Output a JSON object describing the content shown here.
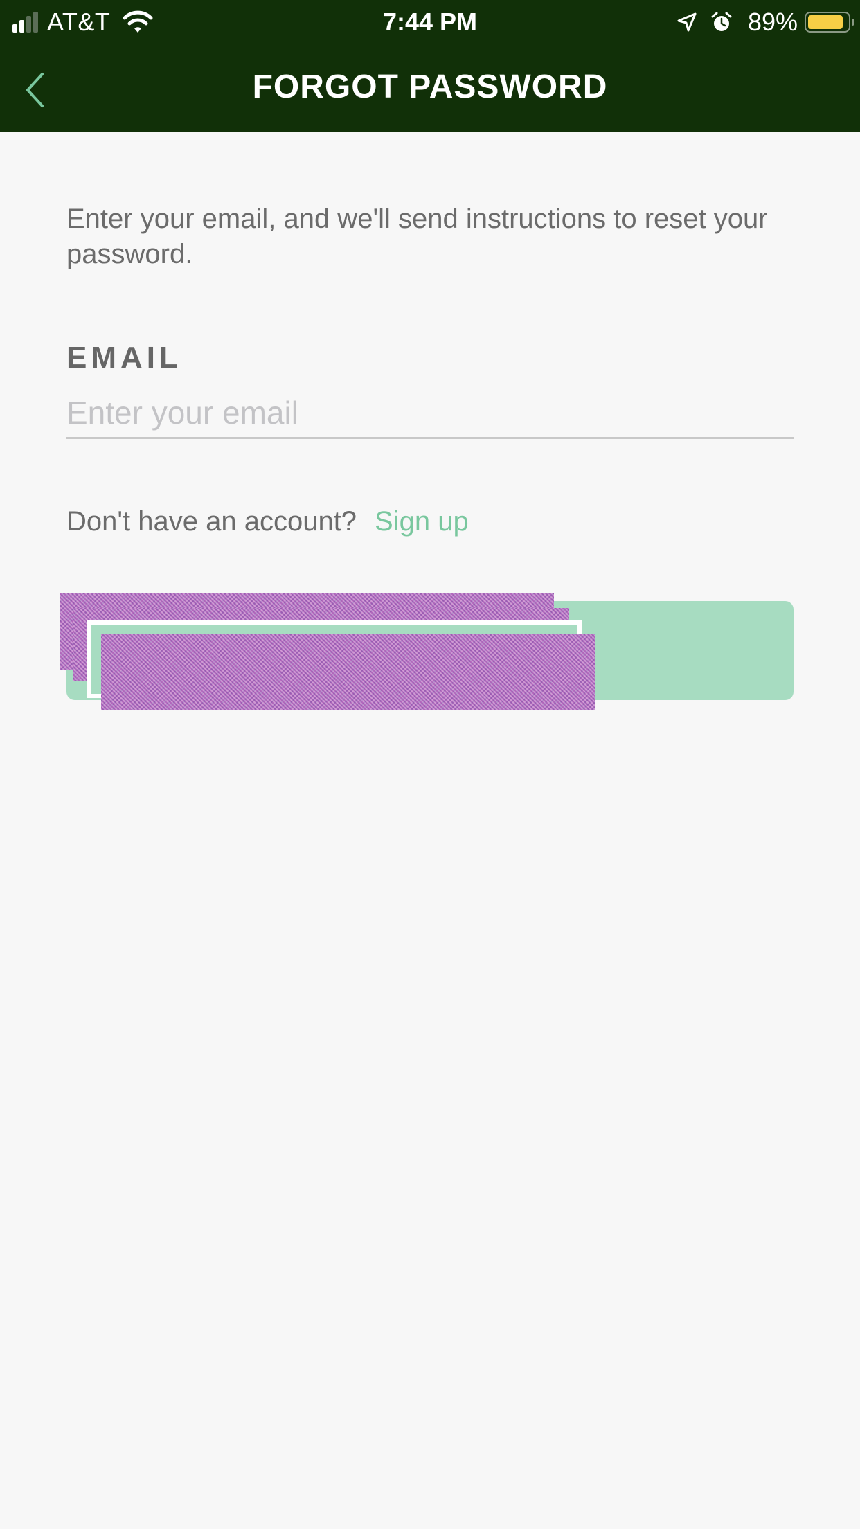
{
  "status_bar": {
    "carrier": "AT&T",
    "time": "7:44 PM",
    "battery_percent": "89%",
    "battery_level": 0.89,
    "icons": [
      "signal-icon",
      "wifi-icon",
      "location-arrow-icon",
      "alarm-icon",
      "battery-icon"
    ]
  },
  "header": {
    "title": "FORGOT PASSWORD",
    "back_icon": "chevron-left-icon"
  },
  "content": {
    "intro_text": "Enter your email, and we'll send instructions to reset your password.",
    "email_label": "EMAIL",
    "email_placeholder": "Enter your email",
    "email_value": "",
    "signup_prompt": "Don't have an account?",
    "signup_link": "Sign up"
  },
  "submit_button": {
    "label": ""
  },
  "colors": {
    "header_bg": "#113008",
    "page_bg": "#f7f7f7",
    "accent_green": "#79c79e",
    "button_bg": "#a7dcc1",
    "text_gray": "#6b6b6b",
    "battery_yellow": "#f7cf46"
  }
}
